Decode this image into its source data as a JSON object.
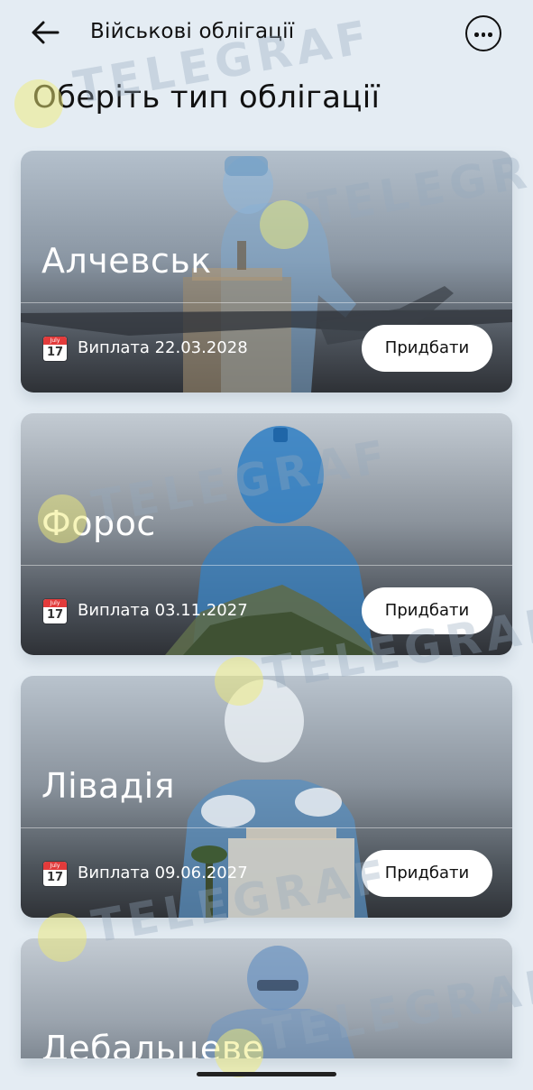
{
  "header": {
    "title": "Військові облігації",
    "back_icon": "arrow-left-icon",
    "more_icon": "more-horizontal-icon"
  },
  "heading": "Оберіть тип облігації",
  "cards": [
    {
      "name": "Алчевськ",
      "payout": "Виплата 22.03.2028",
      "button": "Придбати"
    },
    {
      "name": "Форос",
      "payout": "Виплата 03.11.2027",
      "button": "Придбати"
    },
    {
      "name": "Лівадія",
      "payout": "Виплата 09.06.2027",
      "button": "Придбати"
    },
    {
      "name": "Дебальцеве"
    }
  ],
  "calendar_icon": {
    "month": "July",
    "day": "17"
  },
  "watermark": "TELEGRAF"
}
